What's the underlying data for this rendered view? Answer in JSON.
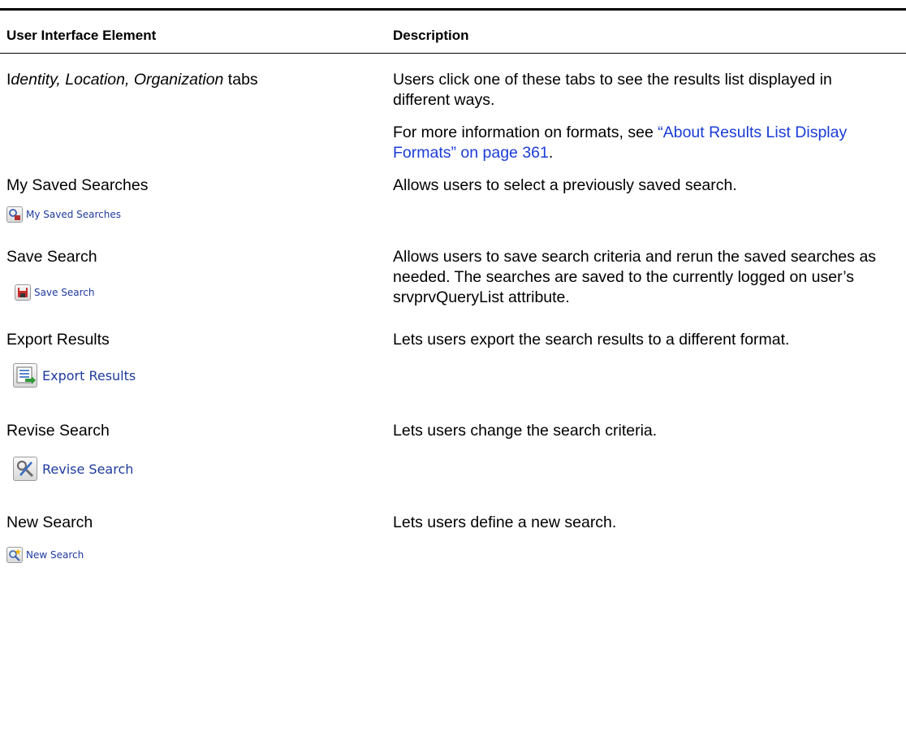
{
  "header": {
    "col1": "User Interface Element",
    "col2": "Description"
  },
  "rows": [
    {
      "element_prefix": "I",
      "element_italic": "dentity, Location, Organization",
      "element_suffix": " tabs",
      "desc1": "Users click one of these tabs to see the results list displayed in different ways.",
      "desc2_pre": "For more information on formats, see ",
      "desc2_link": "“About Results List Display Formats” on page 361",
      "desc2_post": "."
    },
    {
      "element": "My Saved Searches",
      "desc": "Allows users to select a previously saved search.",
      "button_label": "My Saved Searches",
      "icon": "saved-searches-icon"
    },
    {
      "element": "Save Search",
      "desc": "Allows users to save search criteria and rerun the saved searches as needed. The searches are saved to the currently logged on user’s srvprvQueryList attribute.",
      "button_label": "Save Search",
      "icon": "save-floppy-icon"
    },
    {
      "element": "Export Results",
      "desc": "Lets users export the search results to a different format.",
      "button_label": "Export Results",
      "icon": "export-list-icon"
    },
    {
      "element": "Revise Search",
      "desc": "Lets users change the search criteria.",
      "button_label": "Revise Search",
      "icon": "revise-tools-icon"
    },
    {
      "element": "New Search",
      "desc": "Lets users define a new search.",
      "button_label": "New Search",
      "icon": "new-search-magnifier-icon"
    }
  ]
}
